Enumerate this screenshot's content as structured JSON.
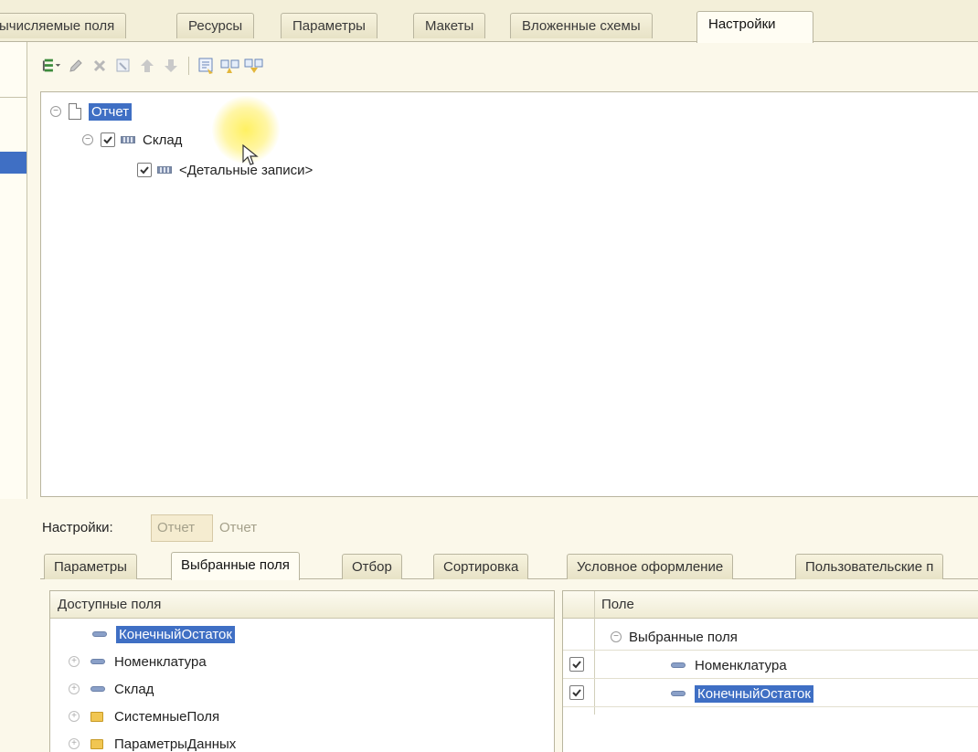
{
  "top_tabs": [
    {
      "label": "ычисляемые поля"
    },
    {
      "label": "Ресурсы"
    },
    {
      "label": "Параметры"
    },
    {
      "label": "Макеты"
    },
    {
      "label": "Вложенные схемы"
    },
    {
      "label": "Настройки",
      "active": true
    }
  ],
  "toolbar": {
    "icons": [
      "add-grouping-icon",
      "edit-icon",
      "delete-icon",
      "filter-icon",
      "move-up-icon",
      "move-down-icon",
      "settings-icon",
      "copy-structure-icon",
      "paste-structure-icon"
    ]
  },
  "tree": {
    "root": "Отчет",
    "group": "Склад",
    "detail": "<Детальные записи>"
  },
  "settings_bar": {
    "label": "Настройки:",
    "button": "Отчет",
    "value": "Отчет"
  },
  "lower_tabs": [
    {
      "label": "Параметры"
    },
    {
      "label": "Выбранные поля",
      "active": true
    },
    {
      "label": "Отбор"
    },
    {
      "label": "Сортировка"
    },
    {
      "label": "Условное оформление"
    },
    {
      "label": "Пользовательские п"
    }
  ],
  "available_fields": {
    "header": "Доступные поля",
    "items": [
      {
        "label": "КонечныйОстаток",
        "icon": "attribute-icon",
        "expandable": false,
        "selected": true
      },
      {
        "label": "Номенклатура",
        "icon": "attribute-icon",
        "expandable": true
      },
      {
        "label": "Склад",
        "icon": "attribute-icon",
        "expandable": true
      },
      {
        "label": "СистемныеПоля",
        "icon": "folder-icon",
        "expandable": true
      },
      {
        "label": "ПараметрыДанных",
        "icon": "folder-icon",
        "expandable": true
      }
    ]
  },
  "selected_fields": {
    "header": "Поле",
    "group_label": "Выбранные поля",
    "items": [
      {
        "label": "Номенклатура",
        "checked": true
      },
      {
        "label": "КонечныйОстаток",
        "checked": true,
        "selected": true
      }
    ]
  },
  "colors": {
    "selection": "#3f6fc4",
    "background": "#fbf8ea",
    "cursor_highlight": "#ffee46"
  }
}
